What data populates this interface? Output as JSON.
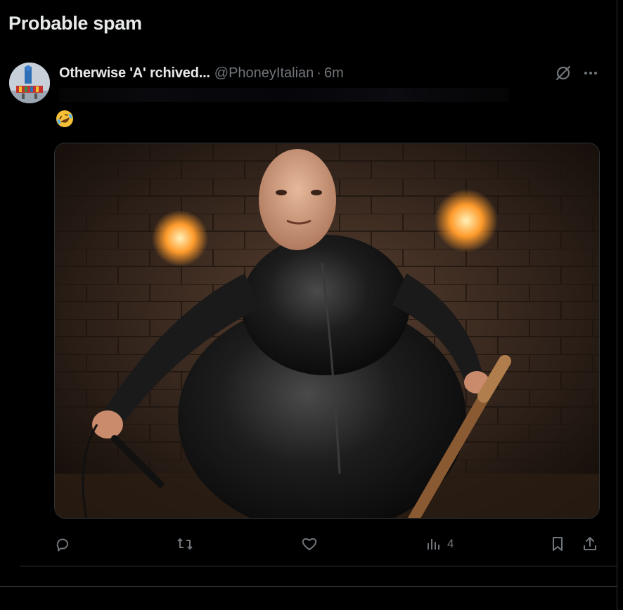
{
  "section": {
    "title": "Probable spam"
  },
  "tweet": {
    "display_name": "Otherwise 'A' rchived...",
    "handle": "@PhoneyItalian",
    "separator": "·",
    "time": "6m",
    "emoji": "rolling-on-the-floor-laughing",
    "media_alt": "Image"
  },
  "icons": {
    "grok": "grok-icon",
    "more": "more-icon",
    "reply": "reply-icon",
    "repost": "repost-icon",
    "like": "like-icon",
    "views": "views-icon",
    "bookmark": "bookmark-icon",
    "share": "share-icon"
  },
  "actions": {
    "reply_count": "",
    "repost_count": "",
    "like_count": "",
    "views_count": "4"
  },
  "colors": {
    "background": "#000000",
    "text": "#e7e9ea",
    "muted": "#71767b",
    "border": "#2f3336"
  }
}
